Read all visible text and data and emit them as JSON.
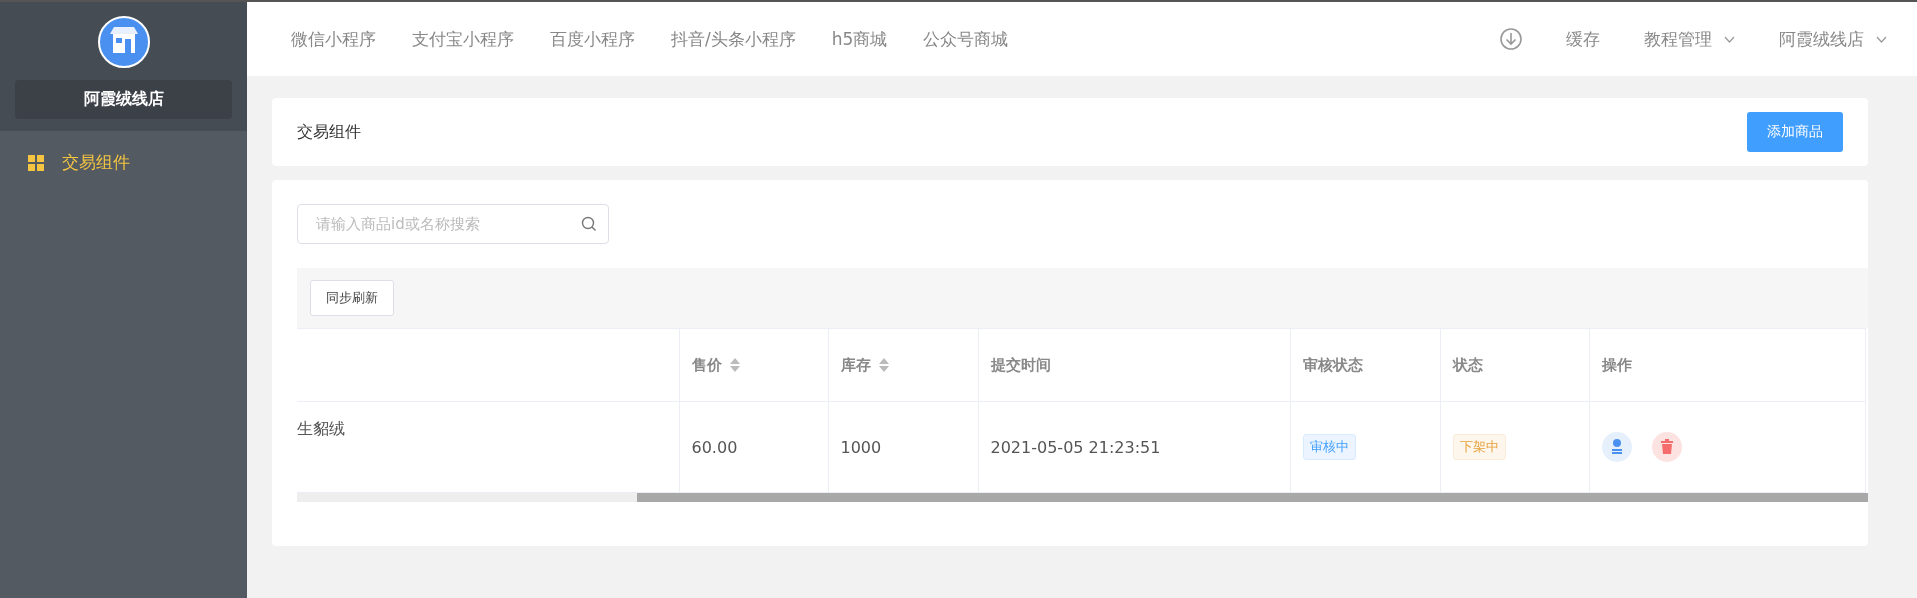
{
  "sidebar": {
    "shop_name": "阿霞绒线店",
    "items": [
      {
        "label": "交易组件",
        "selected": true
      }
    ]
  },
  "top_nav": {
    "items": [
      {
        "label": "微信小程序"
      },
      {
        "label": "支付宝小程序"
      },
      {
        "label": "百度小程序"
      },
      {
        "label": "抖音/头条小程序"
      },
      {
        "label": "h5商城"
      },
      {
        "label": "公众号商城"
      }
    ],
    "right": [
      {
        "kind": "icon"
      },
      {
        "kind": "link",
        "label": "缓存"
      },
      {
        "kind": "dropdown",
        "label": "教程管理"
      },
      {
        "kind": "dropdown",
        "label": "阿霞绒线店"
      }
    ]
  },
  "header_card": {
    "title": "交易组件",
    "button": "添加商品"
  },
  "search": {
    "placeholder": "请输入商品id或名称搜索"
  },
  "toolbar": {
    "button": "同步刷新"
  },
  "table": {
    "columns": [
      {
        "sortable": false
      },
      {
        "label": "售价",
        "sortable": true
      },
      {
        "label": "库存",
        "sortable": true
      },
      {
        "label": "提交时间",
        "sortable": false
      },
      {
        "label": "审核状态",
        "sortable": false
      },
      {
        "label": "状态",
        "sortable": false
      },
      {
        "label": "操作",
        "sortable": false
      }
    ],
    "rows": [
      {
        "name": "生貂绒",
        "price": "60.00",
        "stock": "1000",
        "submitted": "2021-05-05 21:23:51",
        "review_status": {
          "label": "审核中",
          "kind": "info"
        },
        "status": {
          "label": "下架中",
          "kind": "warning"
        }
      }
    ]
  }
}
